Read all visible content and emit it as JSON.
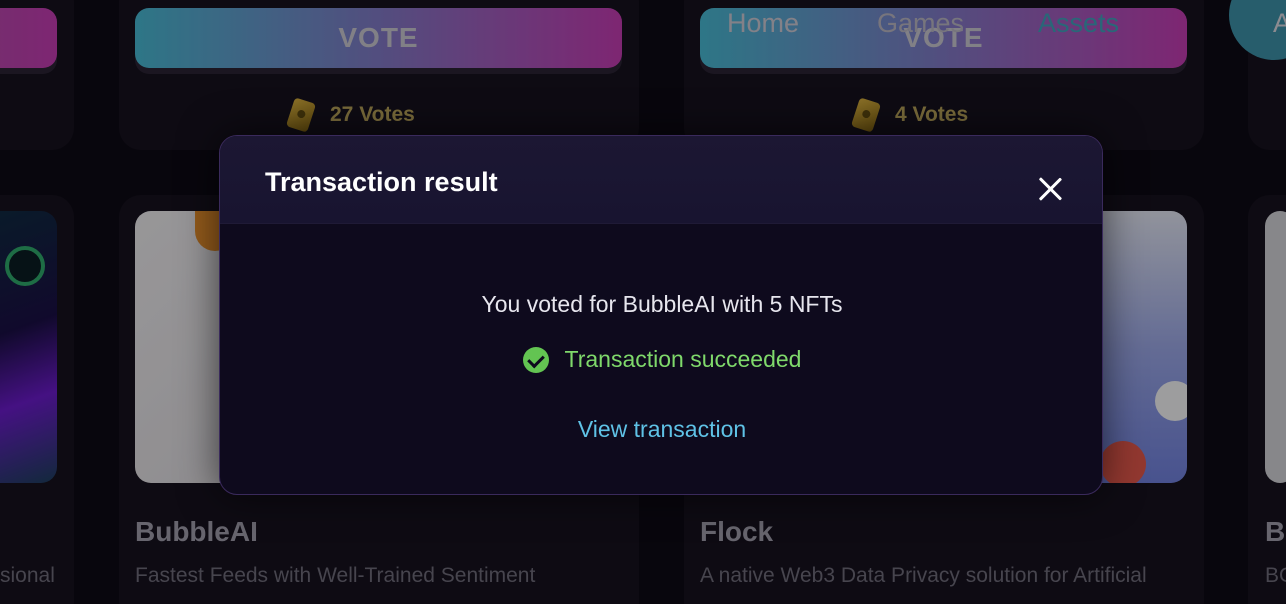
{
  "nav": {
    "home": "Home",
    "games": "Games",
    "assets": "Assets",
    "partial": "A"
  },
  "cards": [
    {
      "vote_label": "VOTE",
      "votes": "27 Votes"
    },
    {
      "vote_label": "VOTE",
      "votes": "4 Votes"
    }
  ],
  "projects": [
    {
      "title": "BubbleAI",
      "desc": "Fastest Feeds with Well-Trained Sentiment"
    },
    {
      "title": "Flock",
      "desc": "A native Web3 Data Privacy solution for Artificial"
    },
    {
      "title": "B",
      "desc": "BG"
    }
  ],
  "left_partial_desc": "sional",
  "modal": {
    "title": "Transaction result",
    "message": "You voted for BubbleAI with 5 NFTs",
    "status": "Transaction succeeded",
    "link": "View transaction"
  },
  "colors": {
    "accent_cyan": "#47b6cf",
    "accent_magenta": "#c23bb0",
    "success": "#7fd96b",
    "link": "#5fc2e6"
  }
}
